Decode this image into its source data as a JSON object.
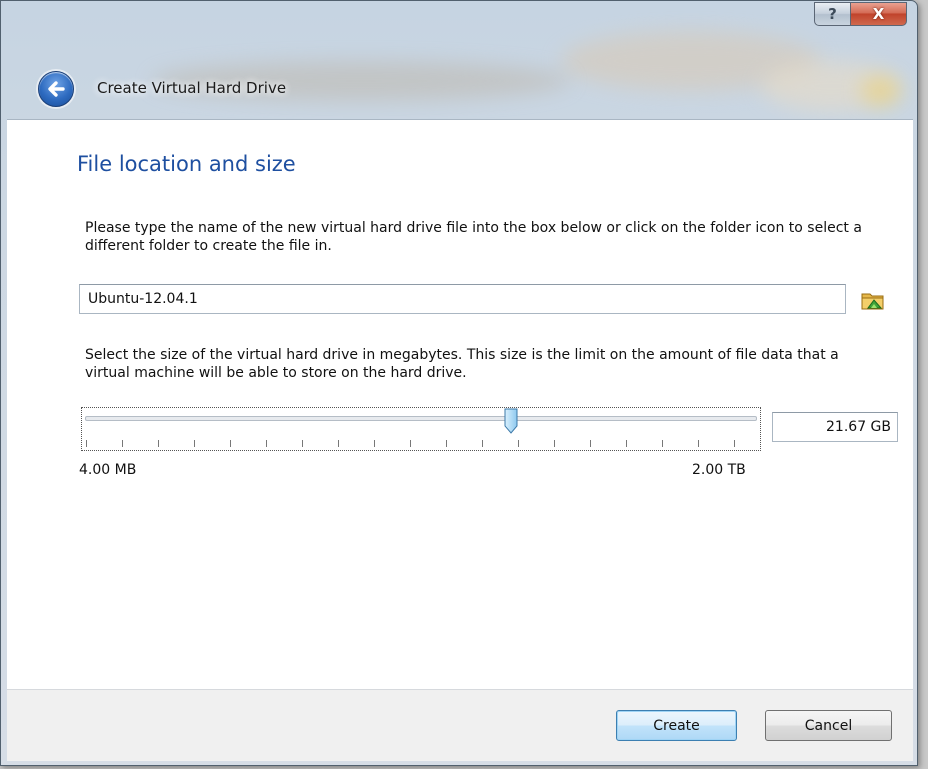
{
  "window": {
    "help_glyph": "?",
    "close_glyph": "X"
  },
  "header": {
    "title": "Create Virtual Hard Drive"
  },
  "page": {
    "title": "File location and size",
    "location_description": "Please type the name of the new virtual hard drive file into the box below or click on the folder icon to select a different folder to create the file in.",
    "file_name": "Ubuntu-12.04.1",
    "size_description": "Select the size of the virtual hard drive in megabytes. This size is the limit on the amount of file data that a virtual machine will be able to store on the hard drive.",
    "size_value": "21.67 GB",
    "size_min_label": "4.00 MB",
    "size_max_label": "2.00 TB",
    "slider_position_fraction": 0.635
  },
  "buttons": {
    "create": "Create",
    "cancel": "Cancel"
  },
  "icons": {
    "back": "back-arrow-icon",
    "folder": "folder-icon"
  },
  "colors": {
    "title_blue": "#1e4fa0",
    "default_button_border": "#3c7fb1"
  }
}
